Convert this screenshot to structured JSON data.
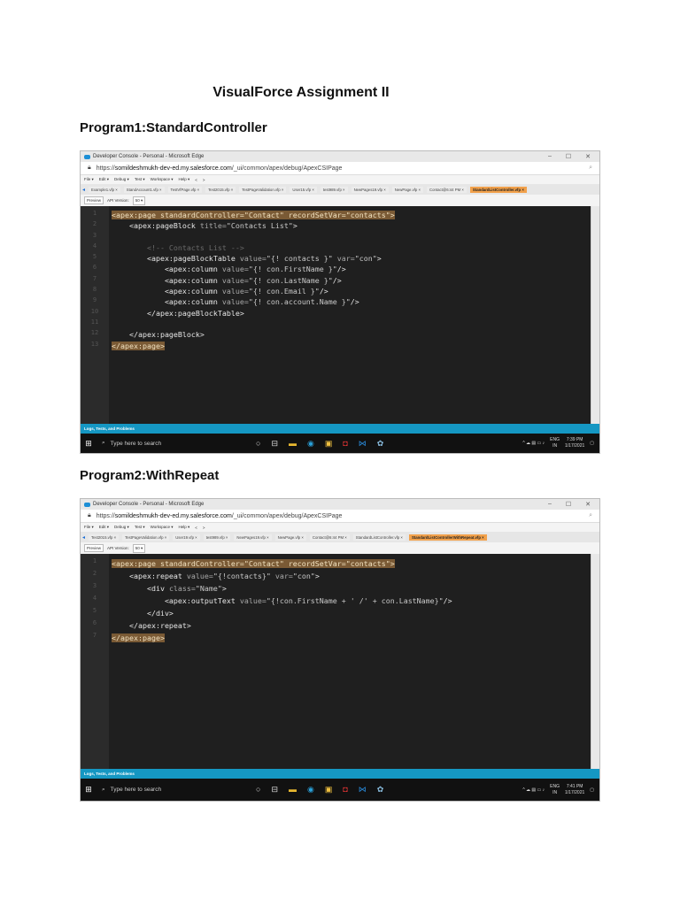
{
  "title": "VisualForce Assignment II",
  "sections": [
    {
      "heading": "Program1:StandardController",
      "window_title": "Developer Console - Personal - Microsoft Edge",
      "url_prefix": "https://",
      "url_host": "somildeshmukh-dev-ed.my.salesforce.com",
      "url_path": "/_ui/common/apex/debug/ApexCSIPage",
      "menu": [
        "File ▾",
        "Edit ▾",
        "Debug ▾",
        "Test ▾",
        "Workspace ▾",
        "Help ▾",
        "<",
        ">"
      ],
      "tabs": [
        "Example1.vfp",
        "StandAccount1.vfp",
        "TestVfPage.vfp",
        "Test2015.vfp",
        "TestPageValidation.vfp",
        "User15.vfp",
        "test989.vfp",
        "NewPages19.vfp",
        "NewPage.vfp",
        "Contact@6:44 PM",
        "StandardListController.vfp"
      ],
      "active_tab": 10,
      "preview": "Preview",
      "api_label": "API Version:",
      "api_value": "50",
      "code": [
        [
          [
            "hl",
            "<apex:page standardController=\"Contact\" recordSetVar=\"contacts\">"
          ]
        ],
        [
          [
            "t",
            "    <apex:pageBlock "
          ],
          [
            "attr",
            "title="
          ],
          [
            "val",
            "\"Contacts List\""
          ],
          [
            "t",
            ">"
          ]
        ],
        [
          [
            "t",
            ""
          ]
        ],
        [
          [
            "cmt",
            "        <!-- Contacts List -->"
          ]
        ],
        [
          [
            "t",
            "        <apex:pageBlockTable "
          ],
          [
            "attr",
            "value="
          ],
          [
            "val",
            "\"{! contacts }\""
          ],
          [
            "attr",
            " var="
          ],
          [
            "val",
            "\"con\""
          ],
          [
            "t",
            ">"
          ]
        ],
        [
          [
            "t",
            "            <apex:column "
          ],
          [
            "attr",
            "value="
          ],
          [
            "val",
            "\"{! con.FirstName }\""
          ],
          [
            "t",
            "/>"
          ]
        ],
        [
          [
            "t",
            "            <apex:column "
          ],
          [
            "attr",
            "value="
          ],
          [
            "val",
            "\"{! con.LastName }\""
          ],
          [
            "t",
            "/>"
          ]
        ],
        [
          [
            "t",
            "            <apex:column "
          ],
          [
            "attr",
            "value="
          ],
          [
            "val",
            "\"{! con.Email }\""
          ],
          [
            "t",
            "/>"
          ]
        ],
        [
          [
            "t",
            "            <apex:column "
          ],
          [
            "attr",
            "value="
          ],
          [
            "val",
            "\"{! con.account.Name }\""
          ],
          [
            "t",
            "/>"
          ]
        ],
        [
          [
            "t",
            "        </apex:pageBlockTable>"
          ]
        ],
        [
          [
            "t",
            ""
          ]
        ],
        [
          [
            "t",
            "    </apex:pageBlock>"
          ]
        ],
        [
          [
            "hl",
            "</apex:page>"
          ]
        ]
      ],
      "logs": "Logs, Tests, and Problems",
      "search": "Type here to search",
      "lang": "ENG",
      "region": "IN",
      "time": "7:39 PM",
      "date": "1/17/2021"
    },
    {
      "heading": "Program2:WithRepeat",
      "window_title": "Developer Console - Personal - Microsoft Edge",
      "url_prefix": "https://",
      "url_host": "somildeshmukh-dev-ed.my.salesforce.com",
      "url_path": "/_ui/common/apex/debug/ApexCSIPage",
      "menu": [
        "File ▾",
        "Edit ▾",
        "Debug ▾",
        "Test ▾",
        "Workspace ▾",
        "Help ▾",
        "<",
        ">"
      ],
      "tabs": [
        "Test2015.vfp",
        "TestPageValidation.vfp",
        "User19.vfp",
        "test989.vfp",
        "NewPages19.vfp",
        "NewPage.vfp",
        "Contact@6:44 PM",
        "StandardListController.vfp",
        "StandardListControllerWithRepeat.vfp"
      ],
      "active_tab": 8,
      "preview": "Preview",
      "api_label": "API Version:",
      "api_value": "50",
      "code": [
        [
          [
            "hl",
            "<apex:page standardController=\"Contact\" recordSetVar=\"contacts\">"
          ]
        ],
        [
          [
            "t",
            "    <apex:repeat "
          ],
          [
            "attr",
            "value="
          ],
          [
            "val",
            "\"{!contacts}\""
          ],
          [
            "attr",
            " var="
          ],
          [
            "val",
            "\"con\""
          ],
          [
            "t",
            ">"
          ]
        ],
        [
          [
            "t",
            "        <div "
          ],
          [
            "attr",
            "class="
          ],
          [
            "val",
            "\"Name\""
          ],
          [
            "t",
            ">"
          ]
        ],
        [
          [
            "t",
            "            <apex:outputText "
          ],
          [
            "attr",
            "value="
          ],
          [
            "val",
            "\"{!con.FirstName + ' /' + con.LastName}\""
          ],
          [
            "t",
            "/>"
          ]
        ],
        [
          [
            "t",
            "        </div>"
          ]
        ],
        [
          [
            "t",
            "    </apex:repeat>"
          ]
        ],
        [
          [
            "hl",
            "</apex:page>"
          ]
        ]
      ],
      "logs": "Logs, Tests, and Problems",
      "search": "Type here to search",
      "lang": "ENG",
      "region": "IN",
      "time": "7:41 PM",
      "date": "1/17/2021"
    }
  ]
}
